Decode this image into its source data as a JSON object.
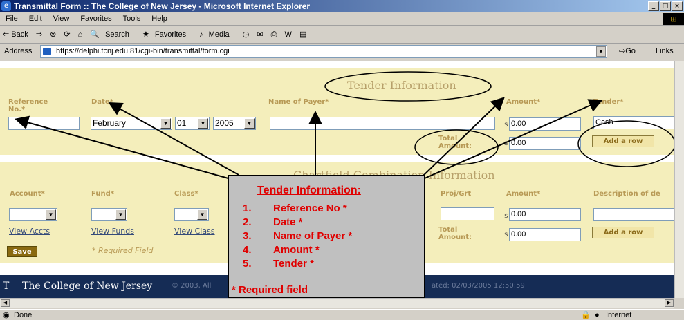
{
  "window": {
    "title": "Transmittal Form :: The College of New Jersey - Microsoft Internet Explorer"
  },
  "menu": [
    "File",
    "Edit",
    "View",
    "Favorites",
    "Tools",
    "Help"
  ],
  "toolbar": {
    "back": "⇐ Back",
    "forward": "⇒",
    "search": "Search",
    "favorites": "Favorites",
    "media": "Media"
  },
  "address": {
    "label": "Address",
    "url": "https://delphi.tcnj.edu:81/cgi-bin/transmittal/form.cgi",
    "go": "Go",
    "links": "Links"
  },
  "tender": {
    "heading": "Tender Information",
    "col_reference": "Reference No.*",
    "col_date": "Date*",
    "col_payer": "Name of Payer*",
    "col_amount": "Amount*",
    "col_tender": "Tender*",
    "date_month": "February",
    "date_day": "01",
    "date_year": "2005",
    "amount_value": "0.00",
    "tender_value": "Cash",
    "total_label": "Total Amount:",
    "total_value": "0.00",
    "add_row": "Add a row",
    "dollar": "$"
  },
  "chartfield": {
    "heading": "Chartfield Combination Information",
    "col_account": "Account*",
    "col_fund": "Fund*",
    "col_class": "Class*",
    "col_projgrt": "Proj/Grt",
    "col_amount": "Amount*",
    "col_desc": "Description of de",
    "view_accts": "View Accts",
    "view_funds": "View Funds",
    "view_class": "View Class",
    "amount_value": "0.00",
    "total_label": "Total Amount:",
    "total_value": "0.00",
    "add_row": "Add a row",
    "save": "Save",
    "required_note": "* Required Field"
  },
  "footer": {
    "college": "The College of New Jersey",
    "copyright": "© 2003, All",
    "updated": "ated: 02/03/2005 12:50:59"
  },
  "callout": {
    "title": "Tender Information:",
    "items": [
      {
        "num": "1.",
        "text": "Reference No *"
      },
      {
        "num": "2.",
        "text": "Date *"
      },
      {
        "num": "3.",
        "text": "Name of Payer *"
      },
      {
        "num": "4.",
        "text": "Amount *"
      },
      {
        "num": "5.",
        "text": "Tender *"
      }
    ],
    "note": "* Required field"
  },
  "status": {
    "left": "Done",
    "zone": "Internet"
  }
}
